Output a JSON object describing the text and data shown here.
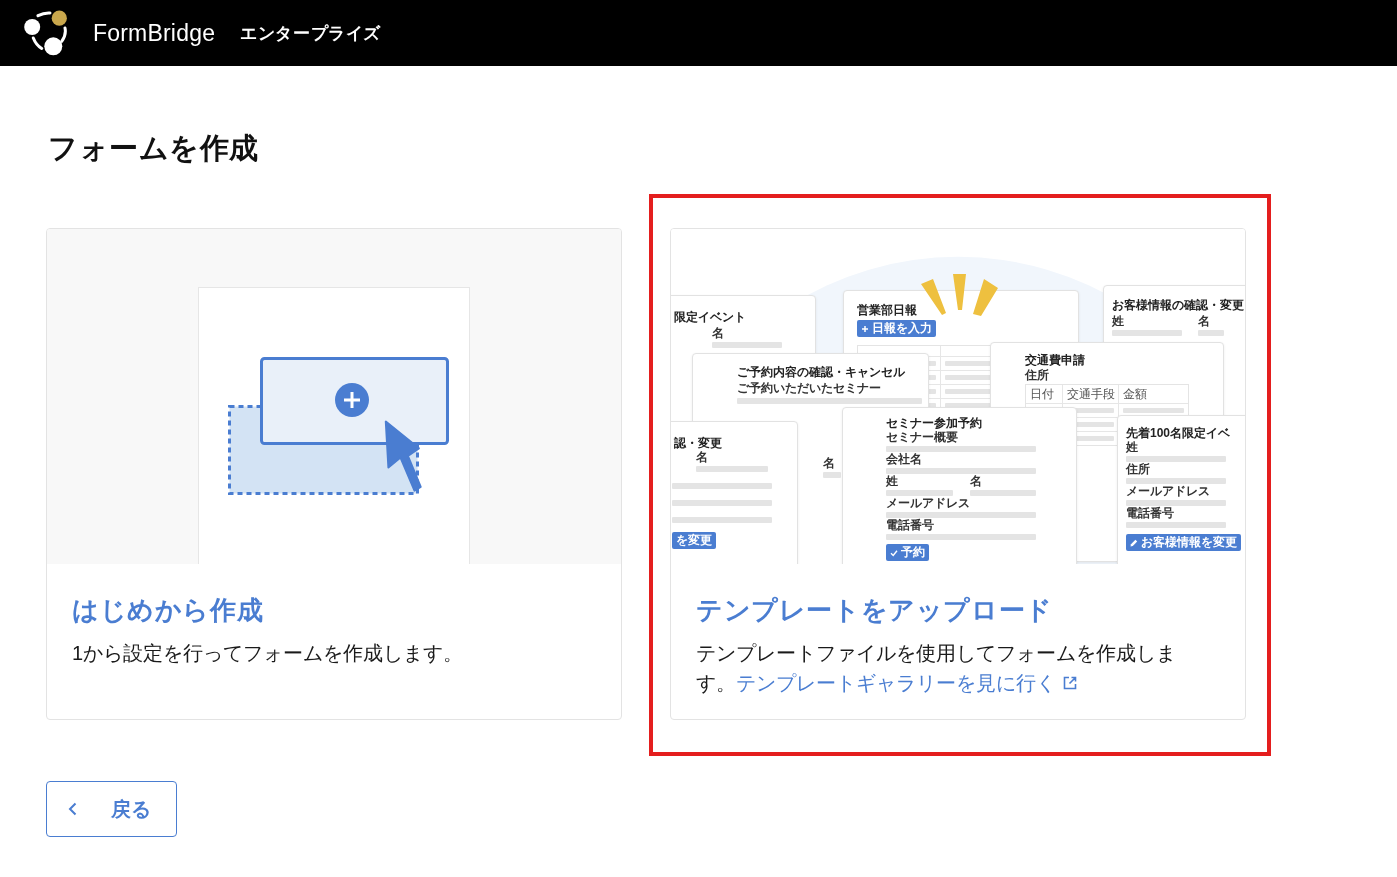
{
  "header": {
    "brand": "FormBridge",
    "edition": "エンタープライズ"
  },
  "page_title": "フォームを作成",
  "options": [
    {
      "kind": "blank",
      "highlighted": false,
      "title": "はじめから作成",
      "description": "1から設定を行ってフォームを作成します。"
    },
    {
      "kind": "template",
      "highlighted": true,
      "title": "テンプレートをアップロード",
      "description": "テンプレートファイルを使用してフォームを作成します。",
      "link": "テンプレートギャラリーを見に行く",
      "mockups": [
        {
          "kind": "form",
          "title": "限定イベント",
          "rows": [
            [
              "名"
            ]
          ]
        },
        {
          "kind": "table",
          "title": "営業部日報",
          "button": "日報を入力"
        },
        {
          "kind": "form",
          "title": "お客様情報の確認・変更",
          "rows": [
            [
              "姓",
              "名"
            ]
          ]
        },
        {
          "kind": "form",
          "title": "ご予約内容の確認・キャンセル",
          "subtitle": "ご予約いただいたセミナー",
          "rows": [
            [
              "名"
            ]
          ]
        },
        {
          "kind": "table",
          "title": "交通費申請",
          "subtitle": "住所",
          "columns": [
            "日付",
            "交通手段",
            "金額"
          ]
        },
        {
          "kind": "form",
          "title": "認・変更",
          "rows": [
            [
              "名"
            ]
          ],
          "button": "を変更"
        },
        {
          "kind": "form",
          "title": "セミナー参加予約",
          "rows": [
            [
              "セミナー概要"
            ],
            [
              "会社名"
            ],
            [
              "姓",
              "名"
            ],
            [
              "メールアドレス"
            ],
            [
              "電話番号"
            ]
          ],
          "button": "予約"
        },
        {
          "kind": "form",
          "title": "先着100名限定イベ",
          "rows": [
            [
              "姓"
            ],
            [
              "住所"
            ],
            [
              "メールアドレス"
            ],
            [
              "電話番号"
            ]
          ],
          "button": "お客様情報を変更"
        }
      ]
    }
  ],
  "back_button": {
    "label": "戻る"
  }
}
